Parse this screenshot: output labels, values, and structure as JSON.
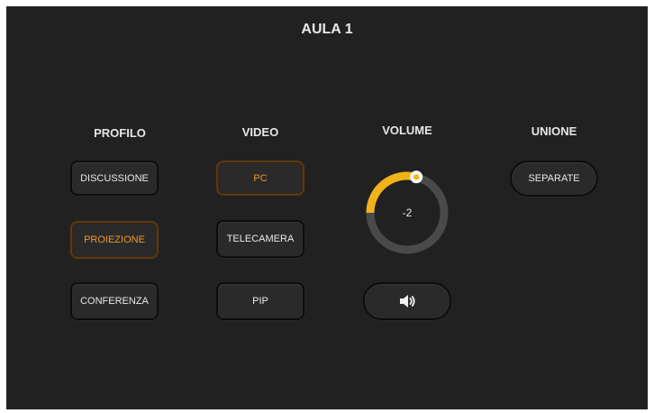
{
  "title": "AULA 1",
  "columns": {
    "profilo": "PROFILO",
    "video": "VIDEO",
    "volume": "VOLUME",
    "unione": "UNIONE"
  },
  "profilo": {
    "discussione": "DISCUSSIONE",
    "proiezione": "PROIEZIONE",
    "conferenza": "CONFERENZA",
    "selected": "PROIEZIONE"
  },
  "video": {
    "pc": "PC",
    "telecamera": "TELECAMERA",
    "pip": "PIP",
    "selected": "PC"
  },
  "volume": {
    "value": "-2",
    "level_fraction": 0.58,
    "mute_icon": "speaker-icon"
  },
  "unione": {
    "separate": "SEPARATE"
  },
  "colors": {
    "background": "#212121",
    "accent": "#f0962b",
    "knob_track": "#4a4a4a",
    "knob_fill": "#f2b21a"
  }
}
